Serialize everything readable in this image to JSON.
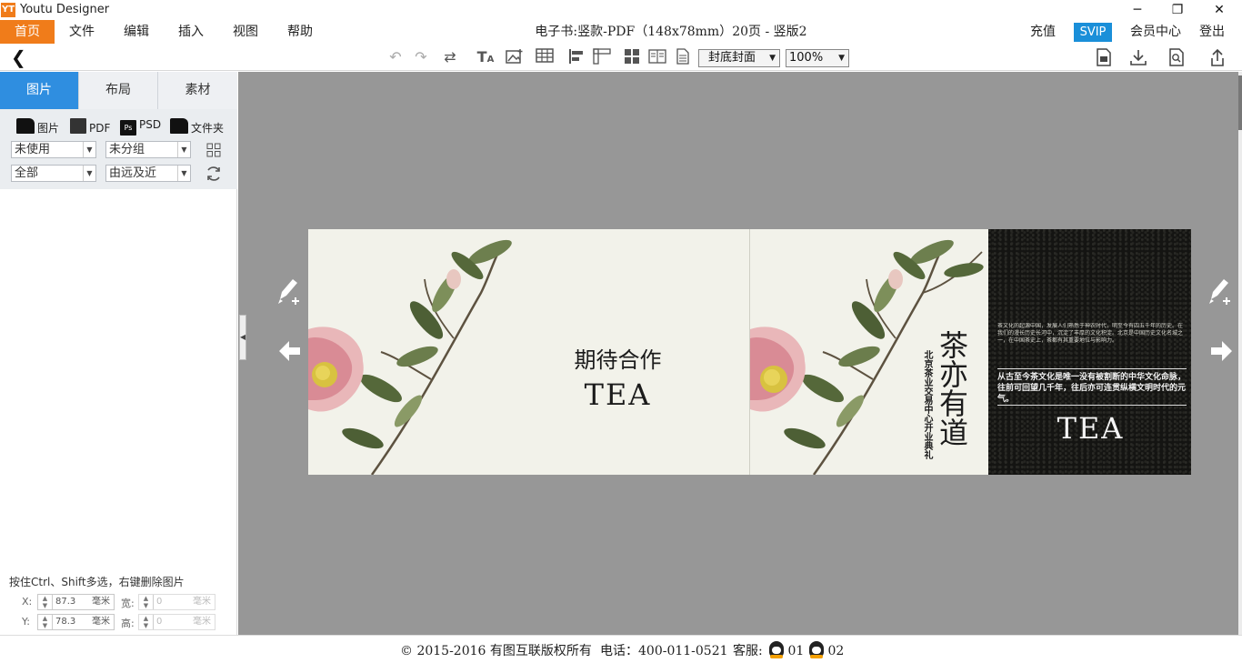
{
  "app": {
    "logo": "YT",
    "title": "Youtu Designer",
    "window_controls": {
      "minimize": "─",
      "maximize": "❐",
      "close": "✕"
    }
  },
  "menu": {
    "items": [
      "首页",
      "文件",
      "编辑",
      "插入",
      "视图",
      "帮助"
    ],
    "active_index": 0,
    "doc_title": "电子书:竖款-PDF（148x78mm）20页 - 竖版2",
    "right": {
      "recharge": "充值",
      "svip": "SVIP",
      "member_center": "会员中心",
      "logout": "登出"
    }
  },
  "toolbar": {
    "page_select": "封底封面",
    "zoom_select": "100%",
    "icons": [
      "undo-icon",
      "redo-icon",
      "shuffle-icon",
      "text-icon",
      "image-icon",
      "table-icon",
      "align-left-icon",
      "ruler-icon",
      "grid-icon",
      "book-icon",
      "page-icon",
      "save-icon",
      "download-icon",
      "preview-icon",
      "share-icon"
    ]
  },
  "left_panel": {
    "tabs": [
      "图片",
      "布局",
      "素材"
    ],
    "active_tab": 0,
    "sources": [
      "图片",
      "PDF",
      "PSD",
      "文件夹"
    ],
    "filters": {
      "usage": "未使用",
      "group": "未分组",
      "scope": "全部",
      "sort": "由远及近"
    },
    "hint": "按住Ctrl、Shift多选，右键删除图片",
    "coords": {
      "x_label": "X:",
      "x_value": "87.3",
      "x_unit": "毫米",
      "y_label": "Y:",
      "y_value": "78.3",
      "y_unit": "毫米",
      "w_label": "宽:",
      "w_value": "0",
      "w_unit": "毫米",
      "h_label": "高:",
      "h_value": "0",
      "h_unit": "毫米"
    }
  },
  "canvas": {
    "left_page": {
      "title": "期待合作",
      "brand": "TEA"
    },
    "right_page": {
      "vertical_title": "茶亦有道",
      "vertical_subtitle": "北京茶业交易中心开业典礼",
      "small_paragraph": "茶文化的起源中国，发展人们熟悉于神农时代，明至今有四五千年的历史。在我们的漫长历史长河中，沉淀了丰厚的文化积淀。北京是中国历史文化名城之一，在中国茶史上，茶都有其重要地位与影响力。",
      "bold_paragraph": "从古至今茶文化是唯一没有被割断的中华文化命脉，往前可回望几千年，往后亦可连贯纵横文明时代的元气。",
      "brand": "TEA"
    }
  },
  "footer": {
    "copyright": "© 2015-2016 有图互联版权所有",
    "phone": "电话：400-011-0521",
    "service_label": "客服:",
    "service_1": "01",
    "service_2": "02"
  },
  "colors": {
    "accent": "#f07c1a",
    "tab_active": "#2f8ee0",
    "svip": "#1a8fd9",
    "canvas_bg": "#979797"
  }
}
